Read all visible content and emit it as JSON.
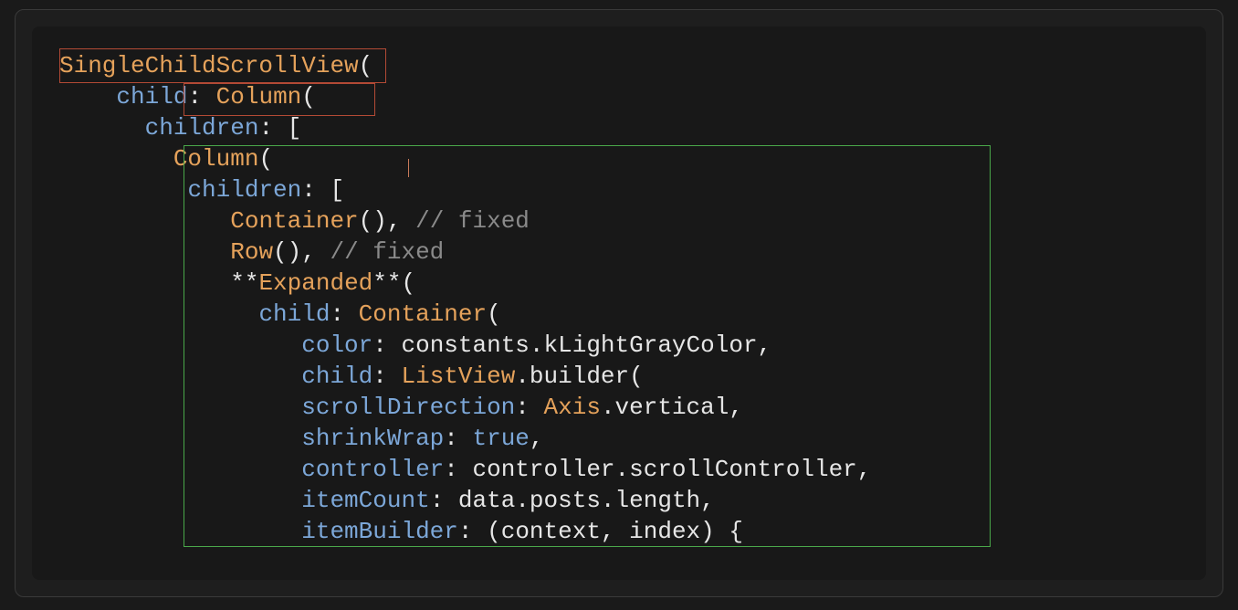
{
  "code": {
    "lines": [
      {
        "indent": 0,
        "segments": [
          {
            "cls": "tok-type",
            "t": "SingleChildScrollView"
          },
          {
            "cls": "tok-punct",
            "t": "("
          }
        ]
      },
      {
        "indent": 4,
        "segments": [
          {
            "cls": "tok-param",
            "t": "child"
          },
          {
            "cls": "tok-punct",
            "t": ": "
          },
          {
            "cls": "tok-type",
            "t": "Column"
          },
          {
            "cls": "tok-punct",
            "t": "("
          }
        ]
      },
      {
        "indent": 6,
        "segments": [
          {
            "cls": "tok-param",
            "t": "children"
          },
          {
            "cls": "tok-punct",
            "t": ": ["
          }
        ]
      },
      {
        "indent": 8,
        "segments": [
          {
            "cls": "tok-type",
            "t": "Column"
          },
          {
            "cls": "tok-punct",
            "t": "("
          }
        ]
      },
      {
        "indent": 9,
        "segments": [
          {
            "cls": "tok-param",
            "t": "children"
          },
          {
            "cls": "tok-punct",
            "t": ": ["
          }
        ]
      },
      {
        "indent": 12,
        "segments": [
          {
            "cls": "tok-type",
            "t": "Container"
          },
          {
            "cls": "tok-punct",
            "t": "(), "
          },
          {
            "cls": "tok-comment",
            "t": "// fixed"
          }
        ]
      },
      {
        "indent": 12,
        "segments": [
          {
            "cls": "tok-type",
            "t": "Row"
          },
          {
            "cls": "tok-punct",
            "t": "(), "
          },
          {
            "cls": "tok-comment",
            "t": "// fixed"
          }
        ]
      },
      {
        "indent": 12,
        "segments": [
          {
            "cls": "tok-stars",
            "t": "**"
          },
          {
            "cls": "tok-type",
            "t": "Expanded"
          },
          {
            "cls": "tok-stars",
            "t": "**"
          },
          {
            "cls": "tok-punct",
            "t": "("
          }
        ]
      },
      {
        "indent": 14,
        "segments": [
          {
            "cls": "tok-param",
            "t": "child"
          },
          {
            "cls": "tok-punct",
            "t": ": "
          },
          {
            "cls": "tok-type",
            "t": "Container"
          },
          {
            "cls": "tok-punct",
            "t": "("
          }
        ]
      },
      {
        "indent": 17,
        "segments": [
          {
            "cls": "tok-param",
            "t": "color"
          },
          {
            "cls": "tok-punct",
            "t": ": "
          },
          {
            "cls": "tok-ident",
            "t": "constants.kLightGrayColor,"
          }
        ]
      },
      {
        "indent": 17,
        "segments": [
          {
            "cls": "tok-param",
            "t": "child"
          },
          {
            "cls": "tok-punct",
            "t": ": "
          },
          {
            "cls": "tok-type",
            "t": "ListView"
          },
          {
            "cls": "tok-punct",
            "t": "."
          },
          {
            "cls": "tok-ident",
            "t": "builder("
          }
        ]
      },
      {
        "indent": 17,
        "segments": [
          {
            "cls": "tok-param",
            "t": "scrollDirection"
          },
          {
            "cls": "tok-punct",
            "t": ": "
          },
          {
            "cls": "tok-type",
            "t": "Axis"
          },
          {
            "cls": "tok-punct",
            "t": "."
          },
          {
            "cls": "tok-ident",
            "t": "vertical,"
          }
        ]
      },
      {
        "indent": 17,
        "segments": [
          {
            "cls": "tok-param",
            "t": "shrinkWrap"
          },
          {
            "cls": "tok-punct",
            "t": ": "
          },
          {
            "cls": "tok-kw",
            "t": "true"
          },
          {
            "cls": "tok-punct",
            "t": ","
          }
        ]
      },
      {
        "indent": 17,
        "segments": [
          {
            "cls": "tok-param",
            "t": "controller"
          },
          {
            "cls": "tok-punct",
            "t": ": "
          },
          {
            "cls": "tok-ident",
            "t": "controller.scrollController,"
          }
        ]
      },
      {
        "indent": 17,
        "segments": [
          {
            "cls": "tok-param",
            "t": "itemCount"
          },
          {
            "cls": "tok-punct",
            "t": ": "
          },
          {
            "cls": "tok-ident",
            "t": "data.posts.length,"
          }
        ]
      },
      {
        "indent": 17,
        "segments": [
          {
            "cls": "tok-param",
            "t": "itemBuilder"
          },
          {
            "cls": "tok-punct",
            "t": ": "
          },
          {
            "cls": "tok-ident",
            "t": "(context, index) {"
          }
        ]
      }
    ]
  },
  "highlights": {
    "red1": "SingleChildScrollView(",
    "red2": "Column(",
    "green": "nested Column block"
  }
}
